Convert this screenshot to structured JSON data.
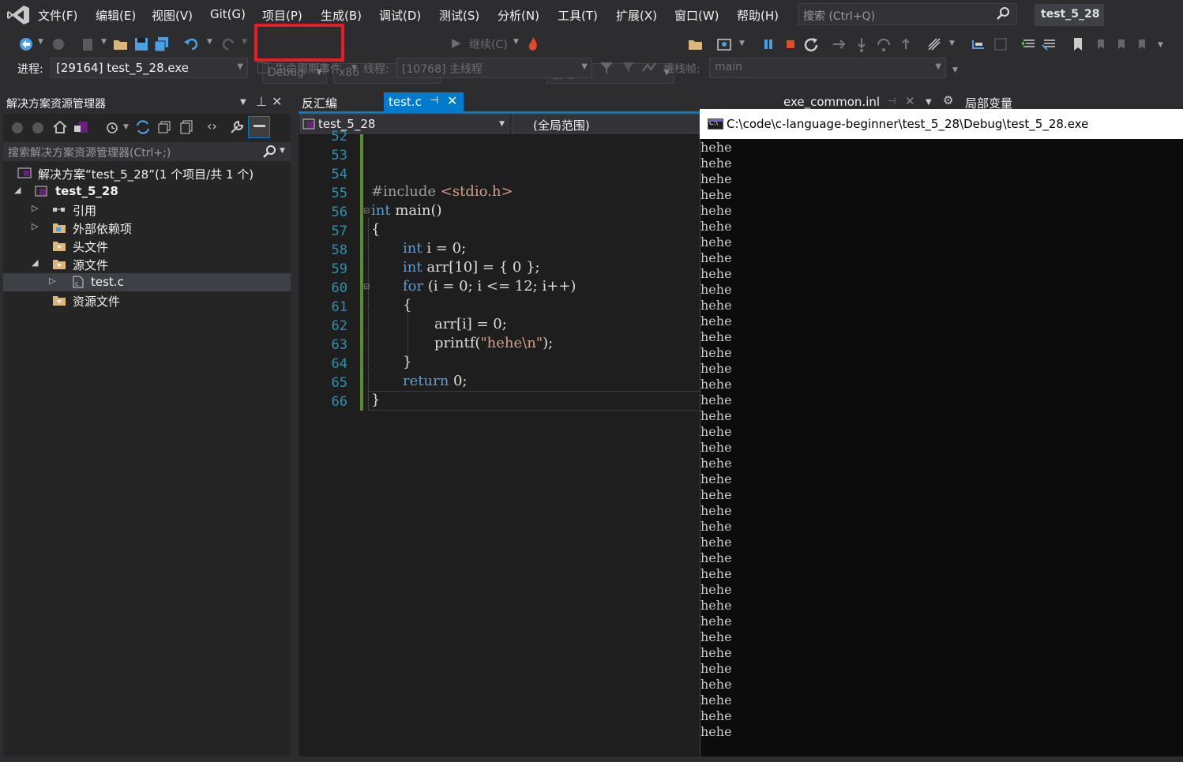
{
  "menu": [
    "文件(F)",
    "编辑(E)",
    "视图(V)",
    "Git(G)",
    "项目(P)",
    "生成(B)",
    "调试(D)",
    "测试(S)",
    "分析(N)",
    "工具(T)",
    "扩展(X)",
    "窗口(W)",
    "帮助(H)"
  ],
  "search": {
    "placeholder": "搜索 (Ctrl+Q)"
  },
  "solution_badge": "test_5_28",
  "toolbar": {
    "config": "Debug",
    "platform": "x86",
    "continue": "继续(C)",
    "auto": "自动"
  },
  "debug_bar": {
    "process_label": "进程:",
    "process_value": "[29164] test_5_28.exe",
    "lifecycle": "生命周期事件",
    "thread_label": "线程:",
    "thread_value": "[10768] 主线程",
    "stack_label": "堆栈帧:",
    "stack_value": "main"
  },
  "solution_explorer": {
    "title": "解决方案资源管理器",
    "search_placeholder": "搜索解决方案资源管理器(Ctrl+;)",
    "items": [
      {
        "label": "解决方案“test_5_28”(1 个项目/共 1 个)"
      },
      {
        "label": "test_5_28"
      },
      {
        "label": "引用"
      },
      {
        "label": "外部依赖项"
      },
      {
        "label": "头文件"
      },
      {
        "label": "源文件"
      },
      {
        "label": "test.c"
      },
      {
        "label": "资源文件"
      }
    ]
  },
  "editor_tabs": {
    "disasm": "反汇编",
    "active": "test.c",
    "right": "exe_common.inl",
    "locals": "局部变量"
  },
  "nav": {
    "project": "test_5_28",
    "scope": "(全局范围)"
  },
  "code": {
    "line_numbers": [
      "52",
      "53",
      "54",
      "55",
      "56",
      "57",
      "58",
      "59",
      "60",
      "61",
      "62",
      "63",
      "64",
      "65",
      "66"
    ],
    "l55_pp": "#include",
    "l55_hdr": "<stdio.h>",
    "l56_kw": "int",
    "l56_rest": " main()",
    "l57": "{",
    "l58_kw": "int",
    "l58_a": " i = ",
    "l58_n": "0",
    "l58_b": ";",
    "l59_kw": "int",
    "l59_a": " arr[10] = { ",
    "l59_n": "0",
    "l59_b": " };",
    "l60_kw": "for",
    "l60_a": " (i = ",
    "l60_n1": "0",
    "l60_b": "; i <= ",
    "l60_n2": "12",
    "l60_c": "; i++)",
    "l61": "{",
    "l62_a": "arr[i] = ",
    "l62_n": "0",
    "l62_b": ";",
    "l63_a": "printf(",
    "l63_s": "\"hehe\\n\"",
    "l63_b": ");",
    "l64": "}",
    "l65_kw": "return",
    "l65_a": " ",
    "l65_n": "0",
    "l65_b": ";",
    "l66": "}"
  },
  "console": {
    "title": "C:\\code\\c-language-beginner\\test_5_28\\Debug\\test_5_28.exe",
    "icon_text": "C:\\",
    "lines": [
      "hehe",
      "hehe",
      "hehe",
      "hehe",
      "hehe",
      "hehe",
      "hehe",
      "hehe",
      "hehe",
      "hehe",
      "hehe",
      "hehe",
      "hehe",
      "hehe",
      "hehe",
      "hehe",
      "hehe",
      "hehe",
      "hehe",
      "hehe",
      "hehe",
      "hehe",
      "hehe",
      "hehe",
      "hehe",
      "hehe",
      "hehe",
      "hehe",
      "hehe",
      "hehe",
      "hehe",
      "hehe",
      "hehe",
      "hehe",
      "hehe",
      "hehe",
      "hehe",
      "hehe"
    ]
  }
}
